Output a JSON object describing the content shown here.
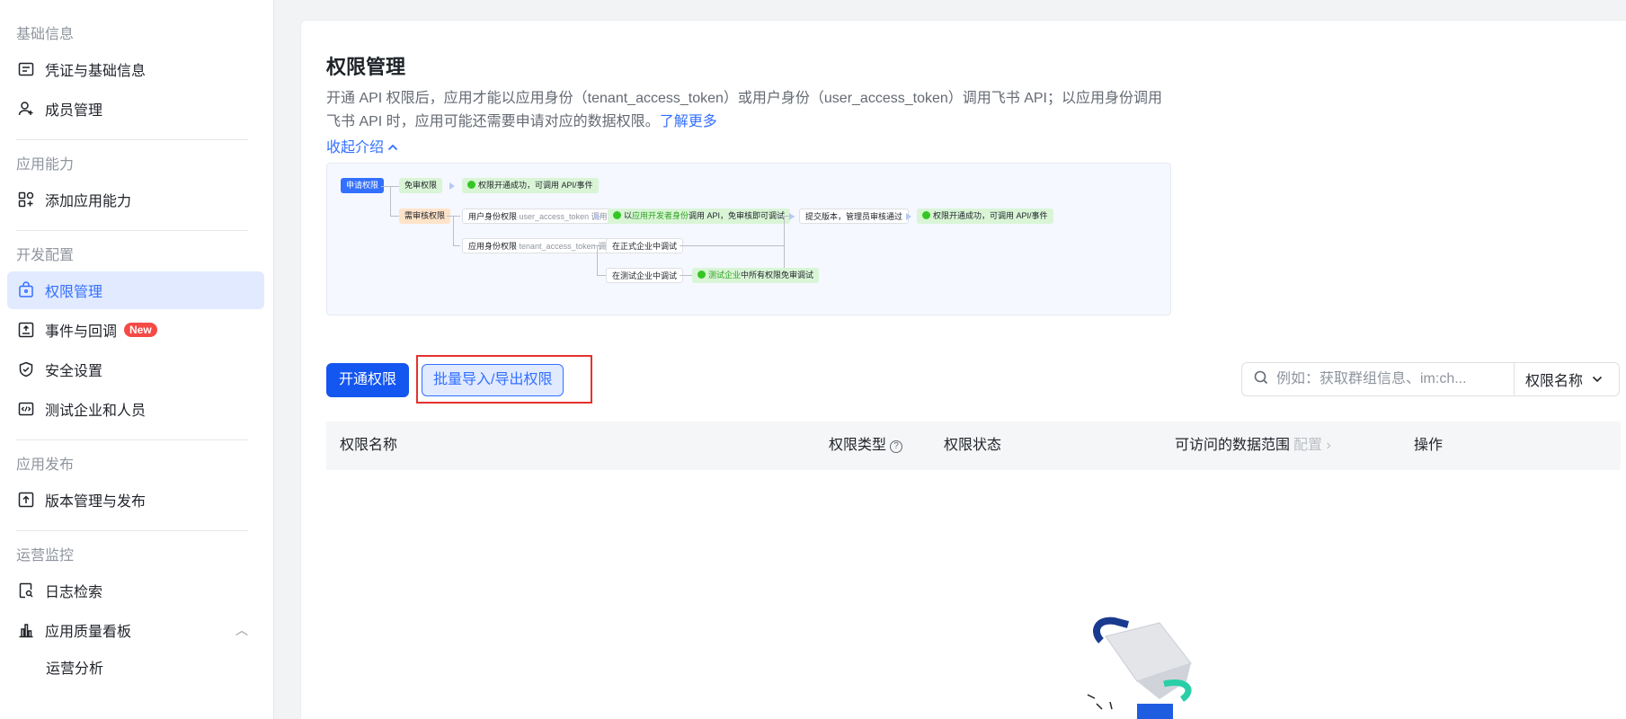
{
  "sidebar": {
    "groups": [
      {
        "title": "基础信息",
        "items": [
          {
            "label": "凭证与基础信息",
            "icon": "credential-icon"
          },
          {
            "label": "成员管理",
            "icon": "add-member-icon"
          }
        ]
      },
      {
        "title": "应用能力",
        "items": [
          {
            "label": "添加应用能力",
            "icon": "add-capability-icon"
          }
        ]
      },
      {
        "title": "开发配置",
        "items": [
          {
            "label": "权限管理",
            "icon": "permission-icon",
            "active": true
          },
          {
            "label": "事件与回调",
            "icon": "event-icon",
            "badge": "New"
          },
          {
            "label": "安全设置",
            "icon": "shield-icon"
          },
          {
            "label": "测试企业和人员",
            "icon": "test-icon"
          }
        ]
      },
      {
        "title": "应用发布",
        "items": [
          {
            "label": "版本管理与发布",
            "icon": "upload-icon"
          }
        ]
      },
      {
        "title": "运营监控",
        "items": [
          {
            "label": "日志检索",
            "icon": "log-search-icon"
          },
          {
            "label": "应用质量看板",
            "icon": "chart-icon",
            "expanded": true
          }
        ],
        "sub_items": [
          "运营分析"
        ]
      }
    ]
  },
  "main": {
    "title": "权限管理",
    "description": "开通 API 权限后，应用才能以应用身份（tenant_access_token）或用户身份（user_access_token）调用飞书 API；以应用身份调用飞书 API 时，应用可能还需要申请对应的数据权限。",
    "learn_more": "了解更多",
    "collapse_label": "收起介绍",
    "diagram": {
      "apply": "申请权限",
      "no_review": "免审权限",
      "no_review_result": "权限开通成功，可调用 API/事件",
      "need_review": "需审核权限",
      "user_perm": "用户身份权限",
      "user_perm_sub": "user_access_token 调用",
      "dev_identity_prefix": "以",
      "dev_identity_hl": "应用开发者身份",
      "dev_identity_suffix": "调用 API，免审核即可调试",
      "submit": "提交版本，管理员审核通过",
      "final_result": "权限开通成功，可调用 API/事件",
      "app_perm": "应用身份权限",
      "app_perm_sub": "tenant_access_token 调用",
      "prod_debug": "在正式企业中调试",
      "test_debug": "在测试企业中调试",
      "test_result_hl": "测试企业",
      "test_result_suffix": "中所有权限免审调试"
    },
    "buttons": {
      "open_permission": "开通权限",
      "batch_import_export": "批量导入/导出权限"
    },
    "search": {
      "placeholder": "例如：获取群组信息、im:ch...",
      "filter_selected": "权限名称"
    },
    "table": {
      "columns": {
        "name": "权限名称",
        "type": "权限类型",
        "status": "权限状态",
        "scope": "可访问的数据范围",
        "scope_config": "配置",
        "action": "操作"
      }
    }
  }
}
